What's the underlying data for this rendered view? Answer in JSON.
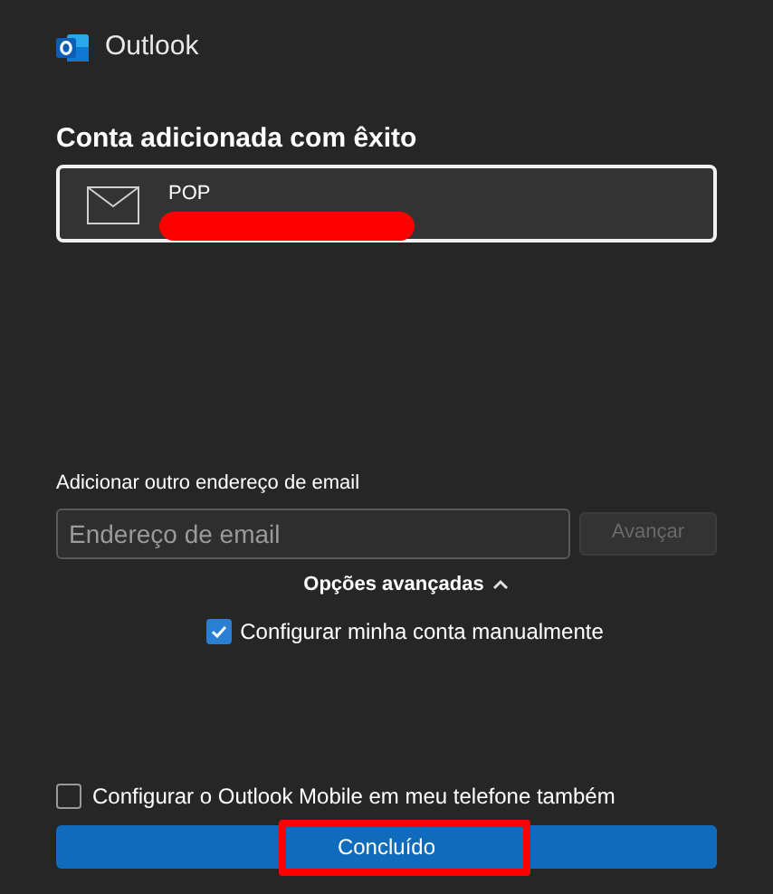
{
  "app": {
    "title": "Outlook"
  },
  "heading": "Conta adicionada com êxito",
  "account": {
    "type": "POP",
    "redacted": true
  },
  "add_email": {
    "label": "Adicionar outro endereço de email",
    "placeholder": "Endereço de email",
    "button": {
      "label": "Avançar",
      "disabled": true
    }
  },
  "advanced": {
    "label": "Opções avançadas",
    "expanded": true,
    "options": [
      {
        "label": "Configurar minha conta manualmente",
        "checked": true
      }
    ]
  },
  "mobile": {
    "label": "Configurar o Outlook Mobile em meu telefone também",
    "checked": false
  },
  "done_button": {
    "label": "Concluído",
    "highlighted": true
  }
}
